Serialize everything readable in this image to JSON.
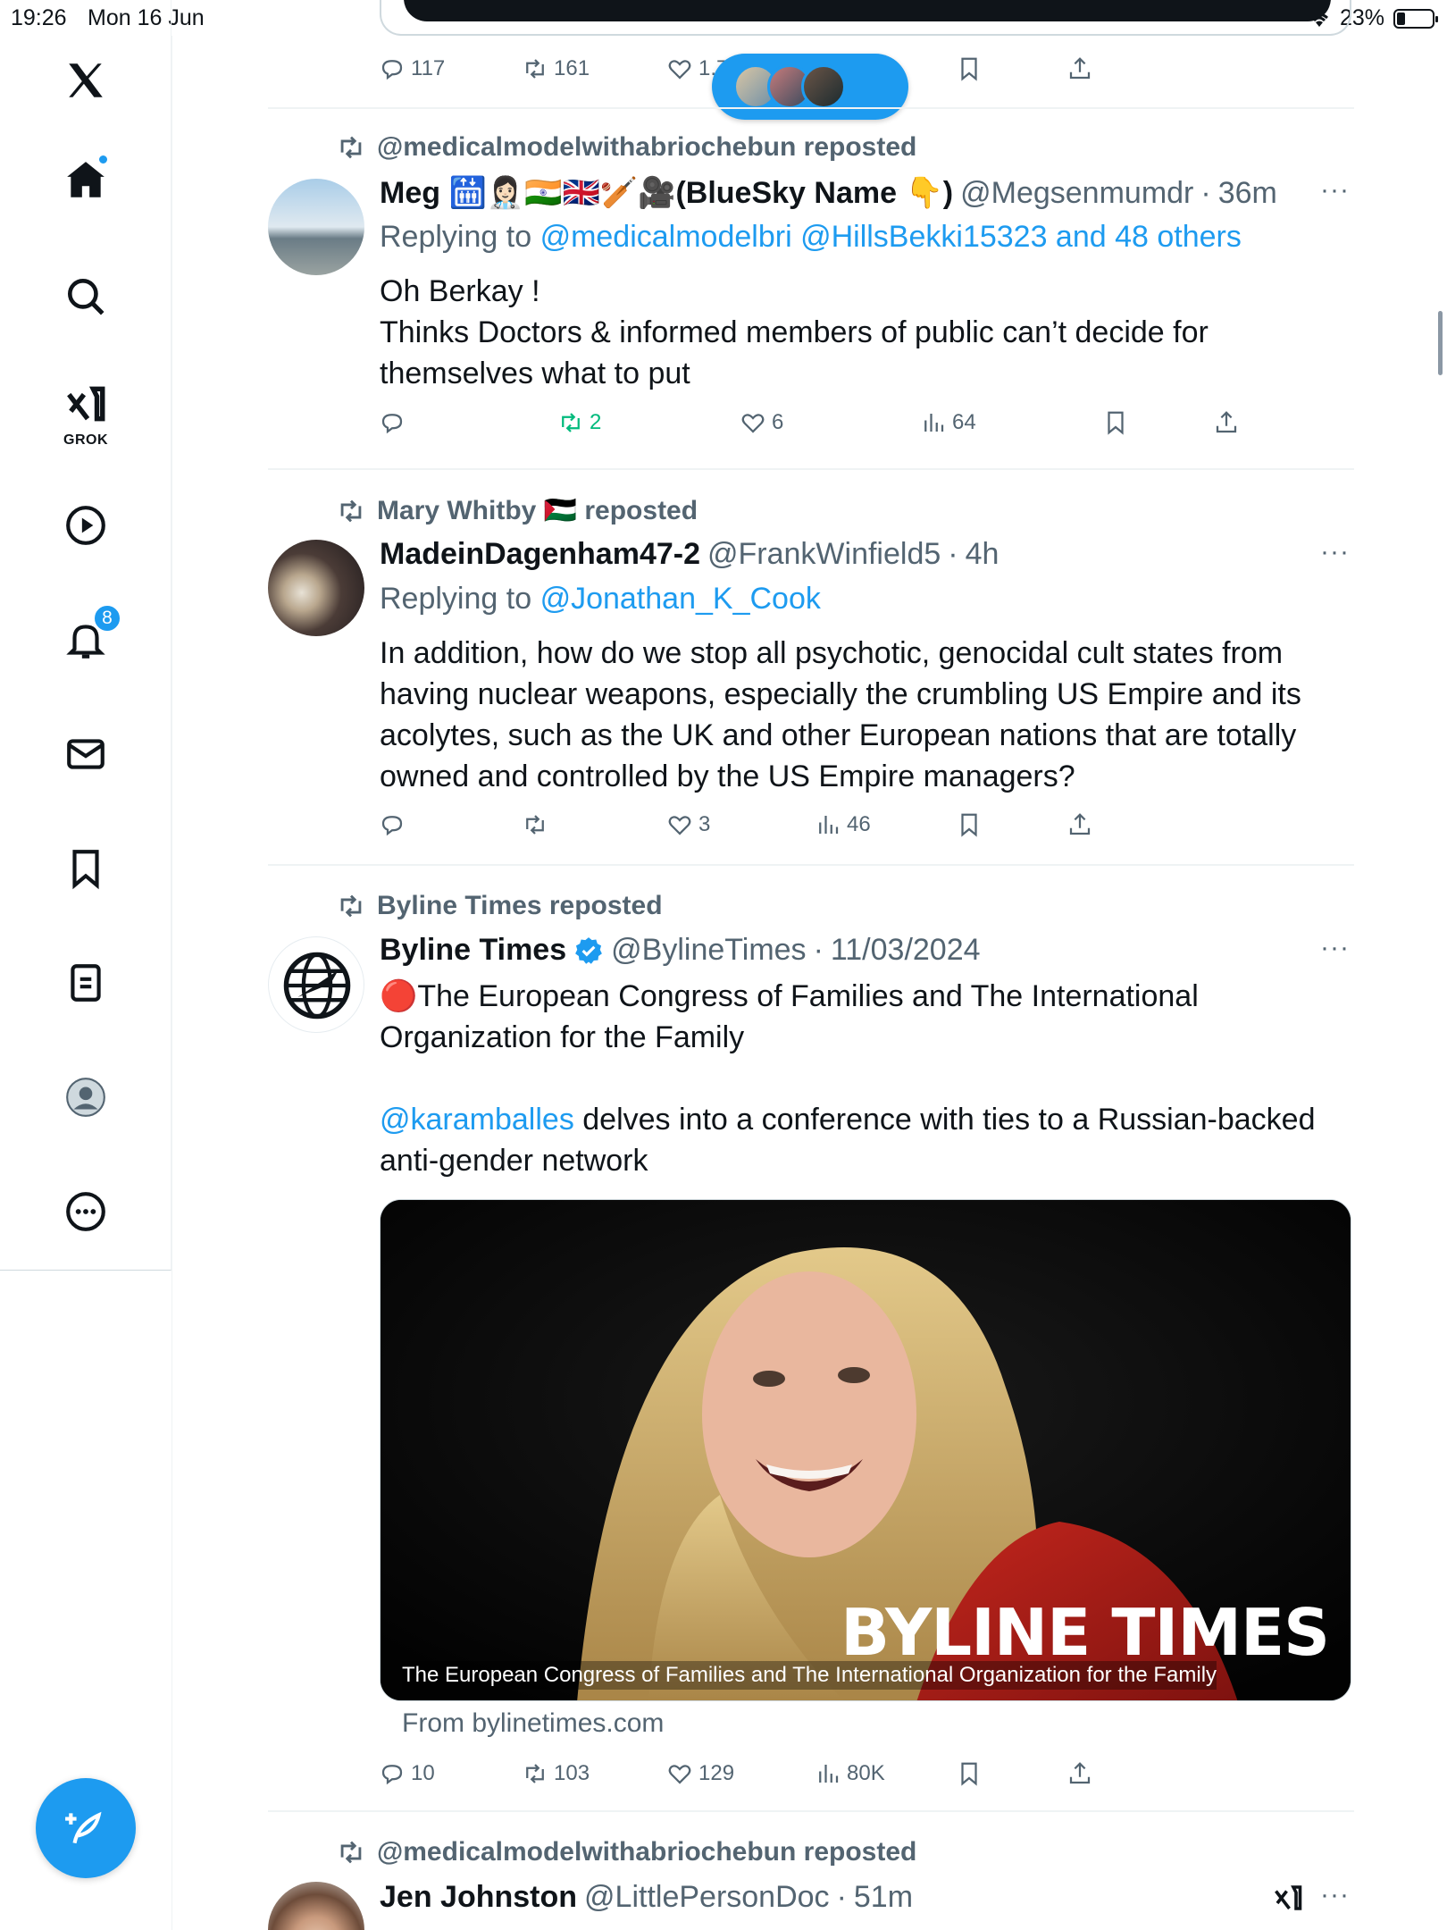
{
  "status_bar": {
    "time": "19:26",
    "date": "Mon 16 Jun",
    "battery": "23%"
  },
  "sidebar": {
    "items": [
      {
        "name": "x-logo"
      },
      {
        "name": "home",
        "has_dot": true
      },
      {
        "name": "search"
      },
      {
        "name": "grok",
        "label": "GROK"
      },
      {
        "name": "video"
      },
      {
        "name": "notifications",
        "badge": "8"
      },
      {
        "name": "messages"
      },
      {
        "name": "bookmarks"
      },
      {
        "name": "lists"
      },
      {
        "name": "profile"
      },
      {
        "name": "more"
      }
    ]
  },
  "top_post": {
    "replies": "117",
    "reposts": "161",
    "likes": "1.7"
  },
  "posts": [
    {
      "reposted_by": "@medicalmodelwithabriochebun reposted",
      "name": "Meg 🛗👩🏻‍⚕️🇮🇳🇬🇧🏏🎥(BlueSky Name 👇)",
      "handle": "@Megsenmumdr",
      "time": "36m",
      "replying_prefix": "Replying to",
      "replying_to": "@medicalmodelbri @HillsBekki15323 and 48 others",
      "text_lines": [
        "Oh Berkay !",
        "Thinks Doctors & informed members of public can’t decide for themselves what to put"
      ],
      "reposts": "2",
      "likes": "6",
      "views": "64"
    },
    {
      "reposted_by": "Mary Whitby 🇵🇸 reposted",
      "name": "MadeinDagenham47-2",
      "handle": "@FrankWinfield5",
      "time": "4h",
      "replying_prefix": "Replying to",
      "replying_to": "@Jonathan_K_Cook",
      "text": "In addition, how do we stop all psychotic, genocidal cult states from having nuclear weapons, especially the crumbling US Empire and its acolytes, such as the UK and other European nations that are totally owned and controlled by the US Empire managers?",
      "likes": "3",
      "views": "46"
    },
    {
      "reposted_by": "Byline Times reposted",
      "name": "Byline Times",
      "handle": "@BylineTimes",
      "time": "11/03/2024",
      "text_1": "🔴The European Congress of Families and The International Organization for the Family",
      "mention": "@karamballes",
      "text_2": " delves into a conference with ties to a Russian-backed anti-gender network",
      "media_caption": "The European Congress of Families and The International Organization for the Family",
      "media_logo": "BYLINE TIMES",
      "from": "From bylinetimes.com",
      "replies": "10",
      "reposts": "103",
      "likes": "129",
      "views": "80K"
    },
    {
      "reposted_by": "@medicalmodelwithabriochebun reposted",
      "name": "Jen Johnston",
      "handle": "@LittlePersonDoc",
      "time": "51m"
    }
  ],
  "colors": {
    "accent": "#1d9bf0",
    "text": "#0f1419",
    "muted": "#536471",
    "repost_green": "#00ba7c"
  }
}
